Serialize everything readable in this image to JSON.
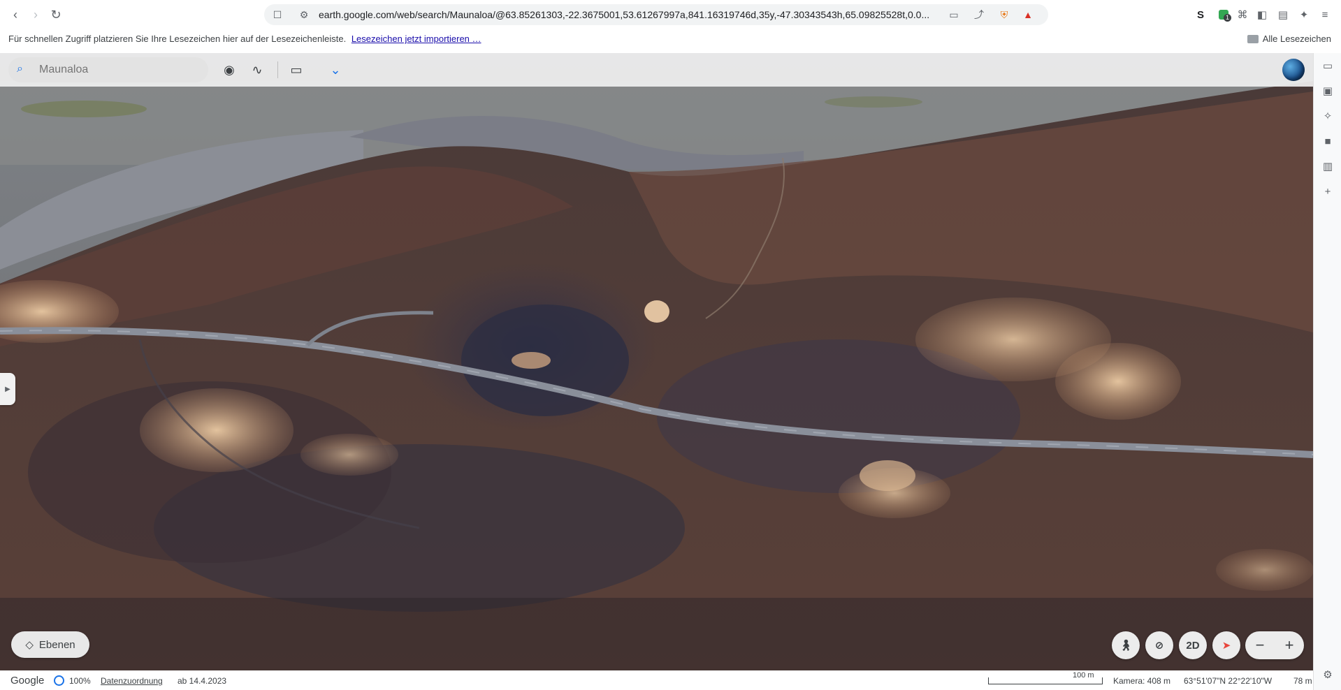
{
  "browser": {
    "url": "earth.google.com/web/search/Maunaloa/@63.85261303,-22.3675001,53.61267997a,841.16319746d,35y,-47.30343543h,65.09825528t,0.0...",
    "extension_badge": "1",
    "extension_s_label": "S"
  },
  "bookmarks_bar": {
    "hint_text": "Für schnellen Zugriff platzieren Sie Ihre Lesezeichen hier auf der Lesezeichenleiste.",
    "import_link": "Lesezeichen jetzt importieren …",
    "all_bookmarks": "Alle Lesezeichen"
  },
  "earth": {
    "search_placeholder": "Maunaloa",
    "layers_label": "Ebenen",
    "view_mode_label": "2D"
  },
  "status_bar": {
    "brand": "Google",
    "progress": "100%",
    "attribution_link": "Datenzuordnung",
    "imagery_date": "ab 14.4.2023",
    "scale_label": "100 m",
    "camera": "Kamera: 408 m",
    "coordinates": "63°51'07\"N 22°22'10\"W",
    "elevation": "78 m"
  },
  "colors": {
    "accent": "#1a73e8",
    "terrain_dark": "#3f2e2c",
    "terrain_brown": "#6b4a3e",
    "lava_blue": "#3a3a52",
    "sand": "#c9a27c",
    "road": "#8a8f9a"
  }
}
